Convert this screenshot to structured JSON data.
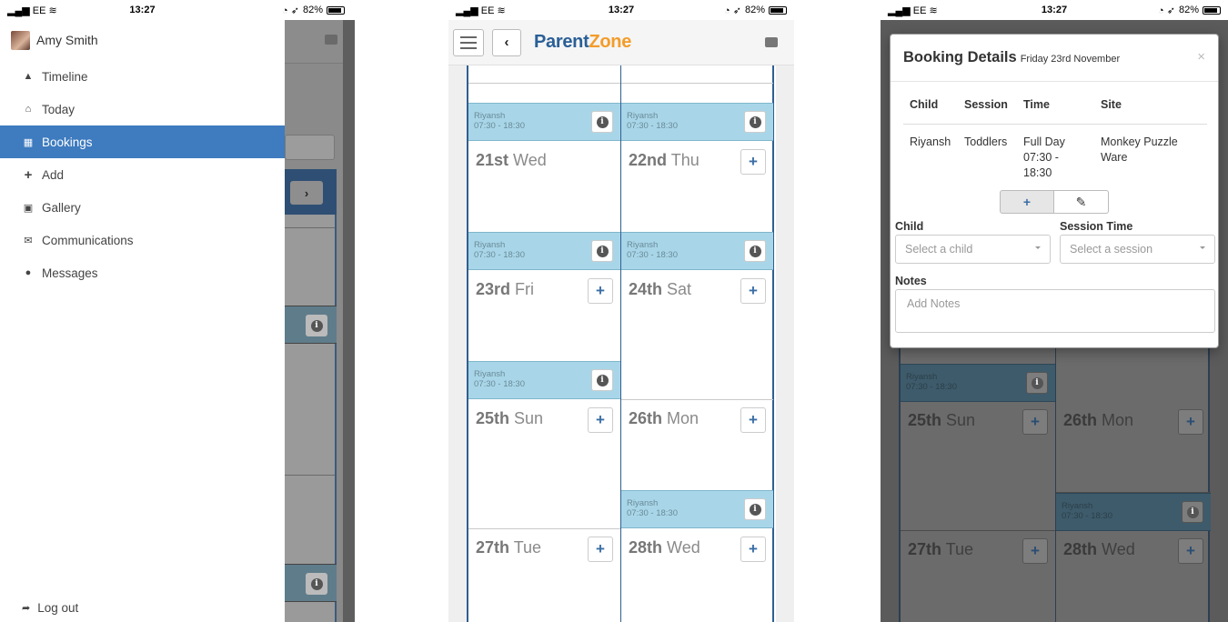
{
  "status_bar": {
    "carrier": "EE",
    "time": "13:27",
    "battery": "82%"
  },
  "drawer": {
    "user_name": "Amy Smith",
    "items": [
      {
        "label": "Timeline",
        "icon": "road-icon"
      },
      {
        "label": "Today",
        "icon": "home-icon"
      },
      {
        "label": "Bookings",
        "icon": "calendar-icon",
        "active": true
      },
      {
        "label": "Add",
        "icon": "plus-icon"
      },
      {
        "label": "Gallery",
        "icon": "image-icon"
      },
      {
        "label": "Communications",
        "icon": "envelope-icon"
      },
      {
        "label": "Messages",
        "icon": "comments-icon"
      }
    ],
    "logout_label": "Log out"
  },
  "app": {
    "logo_part1": "Parent",
    "logo_part2": "Zone",
    "brand_blue": "#2a5f96",
    "brand_orange": "#f39c2a",
    "booked_color": "#a8d6e8",
    "active_menu_color": "#3e7bbf"
  },
  "calendar": {
    "slot_child": "Riyansh",
    "slot_time": "07:30 - 18:30",
    "days": [
      {
        "num": "21st",
        "name": "Wed"
      },
      {
        "num": "22nd",
        "name": "Thu"
      },
      {
        "num": "23rd",
        "name": "Fri"
      },
      {
        "num": "24th",
        "name": "Sat"
      },
      {
        "num": "25th",
        "name": "Sun"
      },
      {
        "num": "26th",
        "name": "Mon"
      },
      {
        "num": "27th",
        "name": "Tue"
      },
      {
        "num": "28th",
        "name": "Wed"
      }
    ]
  },
  "modal": {
    "title": "Booking Details",
    "date": "Friday 23rd November",
    "close": "×",
    "headers": [
      "Child",
      "Session",
      "Time",
      "Site"
    ],
    "row": {
      "child": "Riyansh",
      "session": "Toddlers",
      "time": "Full Day 07:30 - 18:30",
      "site": "Monkey Puzzle Ware"
    },
    "add_button": "+",
    "edit_button": "✎",
    "child_label": "Child",
    "child_placeholder": "Select a child",
    "session_label": "Session Time",
    "session_placeholder": "Select a session",
    "notes_label": "Notes",
    "notes_placeholder": "Add Notes"
  }
}
